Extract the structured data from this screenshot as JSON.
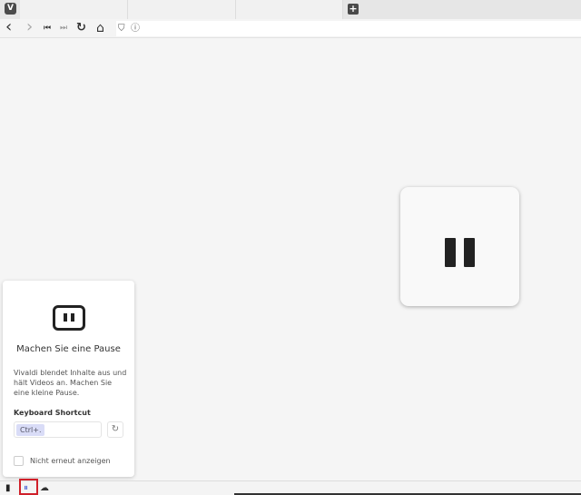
{
  "browser": {
    "logo": "V",
    "new_tab_icon": "plus-icon"
  },
  "nav": {
    "back": "‹",
    "forward": "›",
    "rewind": "⏮",
    "fastforward": "⏭",
    "reload": "↻",
    "home": "⌂",
    "shield": "⛉",
    "info": "ⓘ"
  },
  "break_mode": {
    "pause_icon": "pause-icon"
  },
  "popup": {
    "title": "Machen Sie eine Pause",
    "description": "Vivaldi blendet Inhalte aus und hält Videos an. Machen Sie eine kleine Pause.",
    "shortcut_label": "Keyboard Shortcut",
    "shortcut_value": "Ctrl+.",
    "reset_icon": "↻",
    "dont_show_label": "Nicht erneut anzeigen",
    "dont_show_checked": false
  },
  "statusbar": {
    "panel_icon": "▮",
    "break_icon": "⏸",
    "cloud_icon": "☁",
    "highlight_color": "#d0202a"
  }
}
